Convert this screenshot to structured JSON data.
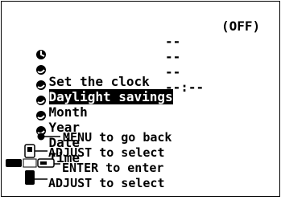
{
  "title": "Set the clock",
  "items": [
    {
      "label": "Daylight savings",
      "value": "(OFF)"
    },
    {
      "label": "Month",
      "value": "--"
    },
    {
      "label": "Year",
      "value": "--"
    },
    {
      "label": "Date",
      "value": "--"
    },
    {
      "label": "Time",
      "value": "--:--"
    }
  ],
  "help": {
    "menu": "MENU to go back",
    "adjust_up": "ADJUST to select",
    "enter": "ENTER to enter",
    "adjust_down": "ADJUST to select"
  },
  "icons": {
    "title": "clock-icon",
    "bullet": "circle-bullet-icon",
    "dpad": "dpad-icon"
  },
  "colors": {
    "foreground": "#000000",
    "background": "#ffffff"
  }
}
